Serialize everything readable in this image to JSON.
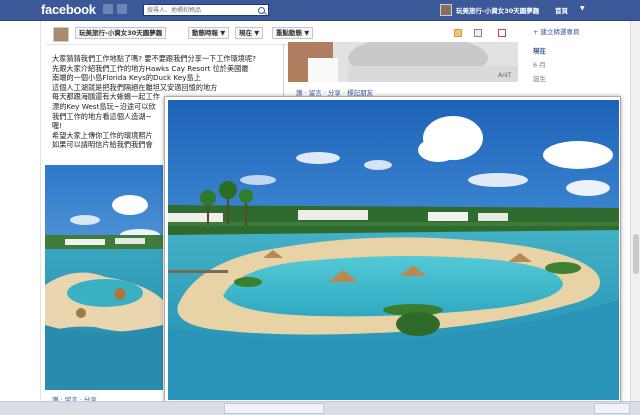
{
  "header": {
    "logo": "facebook",
    "search_placeholder": "搜尋人、地標和物品",
    "profile_name": "玩美旅行-小資女30天圓夢趣",
    "home_label": "首頁",
    "account_caret": "▼"
  },
  "navbar": {
    "page_name": "玩美旅行-小資女30天圓夢趣",
    "tabs": [
      {
        "label": "動態時報 ▼"
      },
      {
        "label": "現在 ▼"
      },
      {
        "label": "重點動態 ▼"
      }
    ]
  },
  "post": {
    "lines": [
      "大家猜猜我們工作地點了嗎? 要不要跟我們分享一下工作環境呢?",
      "先跟大家介紹我們工作的地方Hawks Cay Resort 位於美國最",
      "南端的一個小島Florida Keys的Duck Key島上",
      "這個人工湖就是把我們隔絕在離坦又安適回憶的地方",
      "每天都跟海鷗還有大蜥蜴一起工作",
      "漂的Key West島玩~沿途可以欣",
      "我們工作的地方看這個人造湖~",
      "喔!",
      "希望大家上傳你工作的環境照片",
      "如果可以請明信片給我們我們會"
    ],
    "actions": [
      "讚",
      "留言",
      "分享"
    ]
  },
  "card": {
    "actions": [
      "讚",
      "留言",
      "分享",
      "標記朋友"
    ],
    "watermark": "AnIT"
  },
  "timeline_nav": {
    "create": "+ 建立精選專頁",
    "now": "現在",
    "june": "6 月",
    "born": "誕生"
  },
  "chat": {
    "tabs": [
      {
        "label": ""
      },
      {
        "label": ""
      }
    ]
  }
}
